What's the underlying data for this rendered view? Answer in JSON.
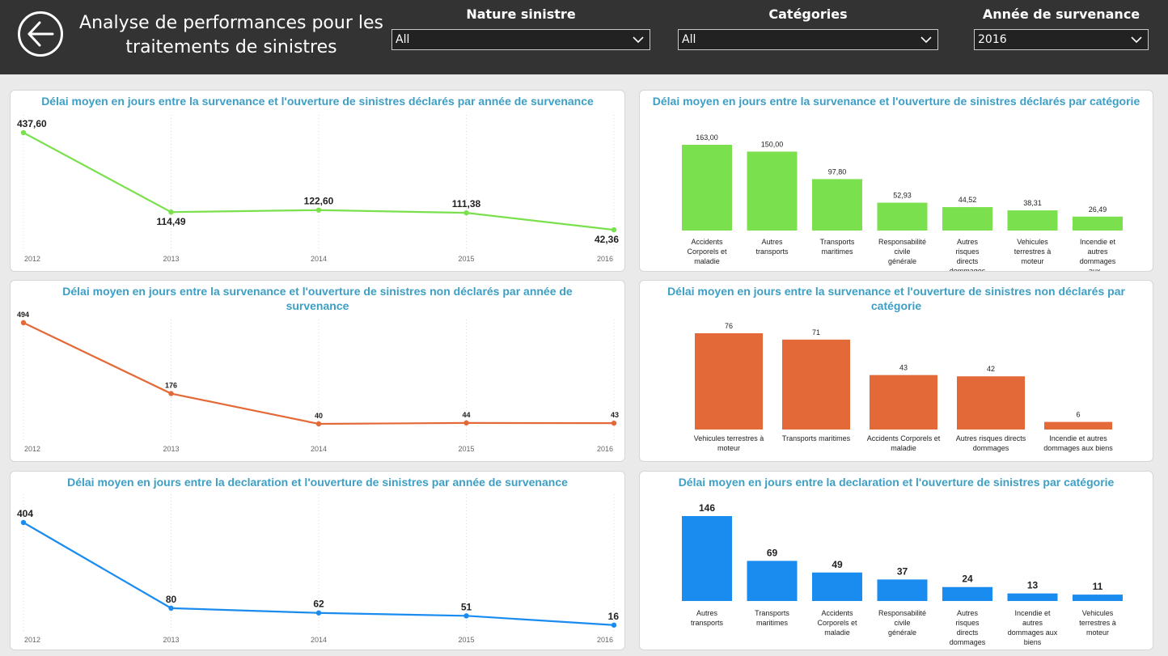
{
  "header": {
    "title": "Analyse de performances pour les traitements de sinistres",
    "back_icon": "arrow-left-icon"
  },
  "slicers": [
    {
      "label": "Nature sinistre",
      "value": "All"
    },
    {
      "label": "Catégories",
      "value": "All"
    },
    {
      "label": "Année de survenance",
      "value": "2016"
    }
  ],
  "colors": {
    "green": "#7ae04e",
    "orange": "#e36a38",
    "blue": "#1a8cf0",
    "title": "#3d9fc5"
  },
  "chart_data": [
    {
      "id": "line1",
      "type": "line",
      "title": "Délai moyen en jours entre la survenance et l'ouverture de sinistres déclarés par année de survenance",
      "x": [
        "2012",
        "2013",
        "2014",
        "2015",
        "2016"
      ],
      "values": [
        437.6,
        114.49,
        122.6,
        111.38,
        42.36
      ],
      "labels": [
        "437,60",
        "114,49",
        "122,60",
        "111,38",
        "42,36"
      ],
      "color": "#7ae04e"
    },
    {
      "id": "bar1",
      "type": "bar",
      "title": "Délai moyen en jours entre la survenance et l'ouverture de sinistres déclarés par catégorie",
      "categories": [
        "Accidents Corporels et maladie",
        "Autres transports",
        "Transports maritimes",
        "Responsabilité civile générale",
        "Autres risques directs dommages",
        "Vehicules terrestres à moteur",
        "Incendie et autres dommages aux..."
      ],
      "values": [
        163.0,
        150.0,
        97.8,
        52.93,
        44.52,
        38.31,
        26.49
      ],
      "labels": [
        "163,00",
        "150,00",
        "97,80",
        "52,93",
        "44,52",
        "38,31",
        "26,49"
      ],
      "color": "#7ae04e"
    },
    {
      "id": "line2",
      "type": "line",
      "title": "Délai moyen en jours entre la survenance et l'ouverture de sinistres non déclarés par année de survenance",
      "x": [
        "2012",
        "2013",
        "2014",
        "2015",
        "2016"
      ],
      "values": [
        494,
        176,
        40,
        44,
        43
      ],
      "labels": [
        "494",
        "176",
        "40",
        "44",
        "43"
      ],
      "color": "#e36a38"
    },
    {
      "id": "bar2",
      "type": "bar",
      "title": "Délai moyen en jours entre la survenance et l'ouverture de sinistres non déclarés par catégorie",
      "categories": [
        "Vehicules terrestres à moteur",
        "Transports maritimes",
        "Accidents Corporels et maladie",
        "Autres risques directs dommages",
        "Incendie et autres dommages aux biens"
      ],
      "values": [
        76,
        71,
        43,
        42,
        6
      ],
      "labels": [
        "76",
        "71",
        "43",
        "42",
        "6"
      ],
      "color": "#e36a38"
    },
    {
      "id": "line3",
      "type": "line",
      "title": "Délai moyen en jours entre la declaration et l'ouverture de sinistres par année de survenance",
      "x": [
        "2012",
        "2013",
        "2014",
        "2015",
        "2016"
      ],
      "values": [
        404,
        80,
        62,
        51,
        16
      ],
      "labels": [
        "404",
        "80",
        "62",
        "51",
        "16"
      ],
      "color": "#1a8cf0"
    },
    {
      "id": "bar3",
      "type": "bar",
      "title": "Délai moyen en jours entre la declaration et l'ouverture de sinistres par catégorie",
      "categories": [
        "Autres transports",
        "Transports maritimes",
        "Accidents Corporels et maladie",
        "Responsabilité civile générale",
        "Autres risques directs dommages",
        "Incendie et autres dommages aux biens",
        "Vehicules terrestres à moteur"
      ],
      "values": [
        146,
        69,
        49,
        37,
        24,
        13,
        11
      ],
      "labels": [
        "146",
        "69",
        "49",
        "37",
        "24",
        "13",
        "11"
      ],
      "color": "#1a8cf0"
    }
  ]
}
